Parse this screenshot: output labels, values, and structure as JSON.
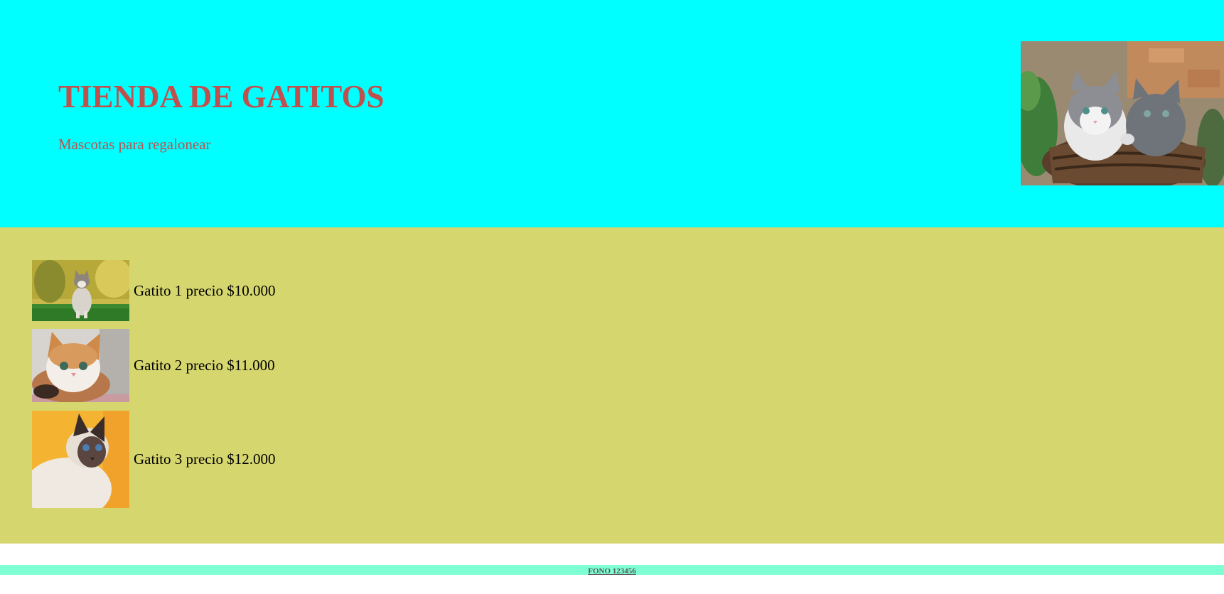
{
  "header": {
    "title": "TIENDA DE GATITOS",
    "subtitle": "Mascotas para regalonear",
    "hero_image": "two-kittens-in-basket"
  },
  "products": [
    {
      "label": "Gatito 1 precio $10.000",
      "image": "tabby-kitten-on-grass"
    },
    {
      "label": "Gatito 2 precio $11.000",
      "image": "orange-white-kitten"
    },
    {
      "label": "Gatito 3 precio $12.000",
      "image": "siamese-cat-yellow-background"
    }
  ],
  "footer": {
    "phone_link": "FONO 123456"
  },
  "colors": {
    "header_bg": "#00ffff",
    "title": "#c0504d",
    "main_bg": "#d6d66e",
    "footer_bar": "#7fffd4"
  }
}
